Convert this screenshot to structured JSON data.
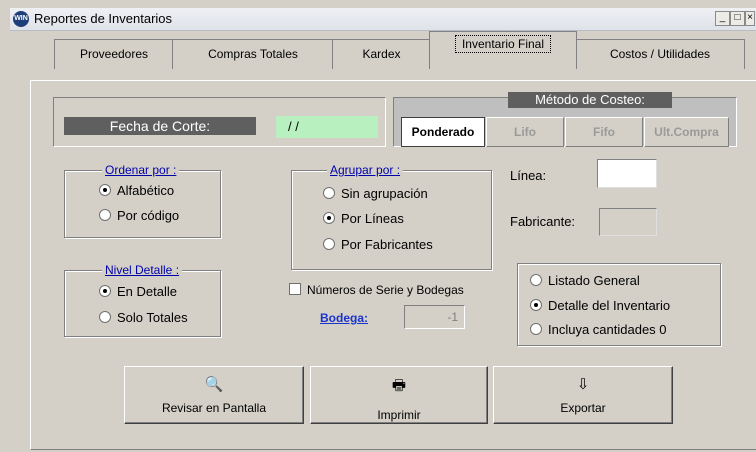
{
  "window": {
    "title": "Reportes de Inventarios",
    "app_icon": "app-globe-icon"
  },
  "tabs": [
    {
      "label": "Proveedores",
      "active": false
    },
    {
      "label": "Compras Totales",
      "active": false
    },
    {
      "label": "Kardex",
      "active": false
    },
    {
      "label": "Inventario Final",
      "active": true
    },
    {
      "label": "Costos / Utilidades",
      "active": false
    }
  ],
  "fecha_corte": {
    "label": "Fecha de Corte:",
    "value": "/ /"
  },
  "metodo_costeo": {
    "title": "Método de Costeo:",
    "options": [
      "Ponderado",
      "Lifo",
      "Fifo",
      "Ult.Compra"
    ],
    "selected": "Ponderado"
  },
  "ordenar_por": {
    "title": "Ordenar por :",
    "options": [
      {
        "label": "Alfabético",
        "selected": true
      },
      {
        "label": "Por código",
        "selected": false
      }
    ]
  },
  "agrupar_por": {
    "title": "Agrupar por :",
    "options": [
      {
        "label": "Sin agrupación",
        "selected": false
      },
      {
        "label": "Por Líneas",
        "selected": true
      },
      {
        "label": "Por Fabricantes",
        "selected": false
      }
    ]
  },
  "linea": {
    "label": "Línea:",
    "value": ""
  },
  "fabricante": {
    "label": "Fabricante:",
    "value": ""
  },
  "nivel_detalle": {
    "title": "Nivel Detalle :",
    "options": [
      {
        "label": "En Detalle",
        "selected": true
      },
      {
        "label": "Solo Totales",
        "selected": false
      }
    ]
  },
  "series_bodegas": {
    "label": "Números de Serie y Bodegas",
    "checked": false
  },
  "bodega": {
    "label": "Bodega:",
    "value": "-1"
  },
  "listado": {
    "options": [
      {
        "label": "Listado General",
        "selected": false
      },
      {
        "label": "Detalle del Inventario",
        "selected": true
      },
      {
        "label": "Incluya cantidades 0",
        "selected": false
      }
    ]
  },
  "actions": {
    "revisar": "Revisar en Pantalla",
    "imprimir": "Imprimir",
    "exportar": "Exportar"
  },
  "colors": {
    "window_bg": "#d4d0c8",
    "fecha_value_bg": "#b8f0c0",
    "label_bg": "#5f5f5f",
    "link_blue": "#1a33cc"
  }
}
